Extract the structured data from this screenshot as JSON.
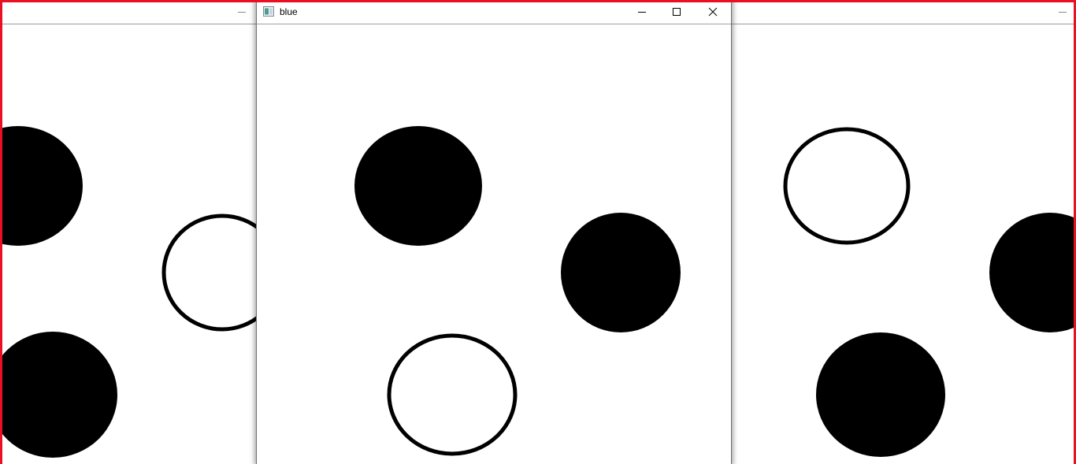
{
  "screen": {
    "frame_color": "#e81123"
  },
  "windows": [
    {
      "id": "left",
      "title": "",
      "buttons_visible": [
        "minimize"
      ],
      "circles": [
        {
          "style": "filled"
        },
        {
          "style": "outline"
        },
        {
          "style": "filled"
        }
      ]
    },
    {
      "id": "center",
      "title": "blue",
      "buttons_visible": [
        "minimize",
        "maximize",
        "close"
      ],
      "circles": [
        {
          "style": "filled"
        },
        {
          "style": "filled"
        },
        {
          "style": "outline"
        }
      ]
    },
    {
      "id": "right",
      "title": "",
      "buttons_visible": [
        "minimize"
      ],
      "circles": [
        {
          "style": "outline"
        },
        {
          "style": "filled"
        },
        {
          "style": "filled"
        }
      ]
    }
  ],
  "icons": {
    "app": "app-window-icon",
    "minimize": "minimize-icon",
    "maximize": "maximize-icon",
    "close": "close-icon"
  }
}
